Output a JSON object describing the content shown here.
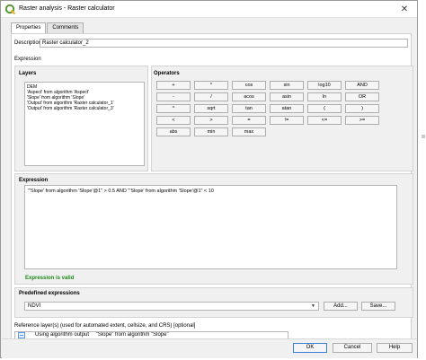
{
  "window": {
    "title": "Raster analysis - Raster calculator",
    "close_symbol": "✕"
  },
  "tabs": [
    {
      "label": "Properties"
    },
    {
      "label": "Comments"
    }
  ],
  "description": {
    "label": "Description",
    "value": "Raster calculator_2"
  },
  "expression_section_label": "Expression",
  "layers": {
    "title": "Layers",
    "items": [
      "DEM",
      "'Aspect' from algorithm 'Aspect'",
      "'Slope' from algorithm 'Slope'",
      "'Output' from algorithm 'Raster calculator_1'",
      "'Output' from algorithm 'Raster calculator_3'"
    ]
  },
  "operators": {
    "title": "Operators",
    "buttons": [
      "+",
      "*",
      "cos",
      "sin",
      "log10",
      "AND",
      "-",
      "/",
      "acos",
      "asin",
      "ln",
      "OR",
      "^",
      "sqrt",
      "tan",
      "atan",
      "(",
      ")",
      "<",
      ">",
      "=",
      "!=",
      "<=",
      ">=",
      "abs",
      "min",
      "max"
    ]
  },
  "expression": {
    "title": "Expression",
    "value": "\"'Slope' from algorithm 'Slope'@1\" > 0.5 AND \"'Slope' from algorithm 'Slope'@1\" < 10",
    "status": "Expression is valid",
    "status_color": "#1a8a1a"
  },
  "predefined": {
    "title": "Predefined expressions",
    "selected": "NDVI",
    "add_label": "Add...",
    "save_label": "Save..."
  },
  "reference_layer": {
    "label": "Reference layer(s) (used for automated extent, cellsize, and CRS) [optional]",
    "value": "Using algorithm output",
    "value_detail": "\"Slope\" from algorithm \"Slope\""
  },
  "footer": {
    "ok_label": "OK",
    "cancel_label": "Cancel",
    "help_label": "Help"
  },
  "colors": {
    "accent": "#3a7fd5",
    "qgis_green": "#589632"
  }
}
